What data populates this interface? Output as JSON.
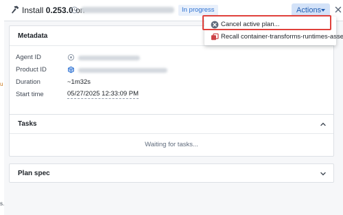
{
  "header": {
    "title_prefix": "Install",
    "version": "0.253.0",
    "title_on": "on",
    "status": "In progress",
    "actions_label": "Actions"
  },
  "menu": {
    "items": [
      {
        "label": "Cancel active plan...",
        "icon": "cancel-circle-icon"
      },
      {
        "label": "Recall container-transforms-runtimes-asset",
        "icon": "recall-icon"
      }
    ]
  },
  "metadata": {
    "title": "Metadata",
    "fields": [
      {
        "label": "Agent ID"
      },
      {
        "label": "Product ID"
      },
      {
        "label": "Duration",
        "value": "~1m32s"
      },
      {
        "label": "Start time",
        "value": "05/27/2025 12:33:09 PM"
      }
    ]
  },
  "tasks": {
    "title": "Tasks",
    "waiting": "Waiting for tasks..."
  },
  "plan_spec": {
    "title": "Plan spec"
  },
  "colors": {
    "accent": "#2d72d2",
    "highlight": "#e0403a",
    "recall_icon": "#cd4246"
  }
}
